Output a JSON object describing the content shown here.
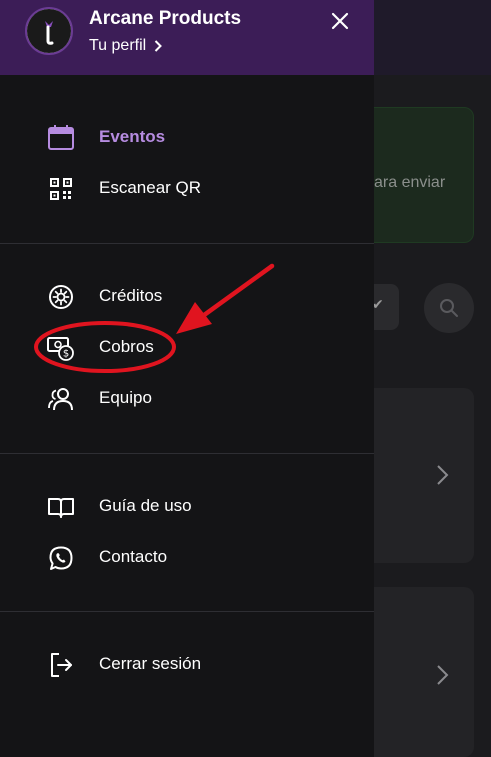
{
  "drawer": {
    "company_name": "Arcane Products",
    "profile_link": "Tu perfil",
    "sections": [
      {
        "items": [
          {
            "label": "Eventos",
            "icon": "calendar-icon",
            "active": true
          },
          {
            "label": "Escanear QR",
            "icon": "qr-code-icon",
            "active": false
          }
        ]
      },
      {
        "items": [
          {
            "label": "Créditos",
            "icon": "credits-icon",
            "active": false
          },
          {
            "label": "Cobros",
            "icon": "payments-icon",
            "active": false
          },
          {
            "label": "Equipo",
            "icon": "team-icon",
            "active": false
          }
        ]
      },
      {
        "items": [
          {
            "label": "Guía de uso",
            "icon": "book-icon",
            "active": false
          },
          {
            "label": "Contacto",
            "icon": "whatsapp-icon",
            "active": false
          }
        ]
      },
      {
        "items": [
          {
            "label": "Cerrar sesión",
            "icon": "logout-icon",
            "active": false
          }
        ]
      }
    ]
  },
  "background": {
    "green_card_text": "ara enviar"
  },
  "colors": {
    "drawer_bg": "#141416",
    "header_bg": "#3c1d57",
    "accent": "#b68ce0",
    "annotation": "#e0141f"
  }
}
